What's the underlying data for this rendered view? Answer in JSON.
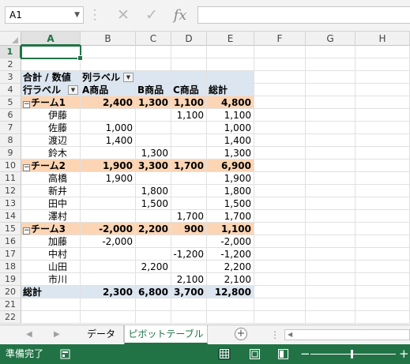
{
  "formula_bar": {
    "name_box": "A1",
    "fx_label": "fx",
    "formula_value": ""
  },
  "columns": [
    "A",
    "B",
    "C",
    "D",
    "E",
    "F",
    "G",
    "H"
  ],
  "rows": [
    {
      "n": "1",
      "cells": []
    },
    {
      "n": "2",
      "cells": []
    },
    {
      "n": "3",
      "style": "header",
      "cells": [
        {
          "col": "A",
          "v": "合計 / 数値",
          "align": "txt",
          "bold": true
        },
        {
          "col": "B",
          "v": "列ラベル",
          "align": "txt",
          "bold": true,
          "dropdown": true
        }
      ]
    },
    {
      "n": "4",
      "style": "header",
      "cells": [
        {
          "col": "A",
          "v": "行ラベル",
          "align": "txt",
          "bold": true,
          "dropdown": true
        },
        {
          "col": "B",
          "v": "A商品",
          "align": "txt",
          "bold": true
        },
        {
          "col": "C",
          "v": "B商品",
          "align": "txt",
          "bold": true
        },
        {
          "col": "D",
          "v": "C商品",
          "align": "txt",
          "bold": true
        },
        {
          "col": "E",
          "v": "総計",
          "align": "txt",
          "bold": true
        }
      ]
    },
    {
      "n": "5",
      "style": "team",
      "cells": [
        {
          "col": "A",
          "v": "チーム1",
          "align": "txt",
          "collapse": "⊟"
        },
        {
          "col": "B",
          "v": "2,400",
          "align": "num"
        },
        {
          "col": "C",
          "v": "1,300",
          "align": "num"
        },
        {
          "col": "D",
          "v": "1,100",
          "align": "num"
        },
        {
          "col": "E",
          "v": "4,800",
          "align": "num"
        }
      ]
    },
    {
      "n": "6",
      "cells": [
        {
          "col": "A",
          "v": "伊藤",
          "align": "ind"
        },
        {
          "col": "D",
          "v": "1,100",
          "align": "num"
        },
        {
          "col": "E",
          "v": "1,100",
          "align": "num"
        }
      ]
    },
    {
      "n": "7",
      "cells": [
        {
          "col": "A",
          "v": "佐藤",
          "align": "ind"
        },
        {
          "col": "B",
          "v": "1,000",
          "align": "num"
        },
        {
          "col": "E",
          "v": "1,000",
          "align": "num"
        }
      ]
    },
    {
      "n": "8",
      "cells": [
        {
          "col": "A",
          "v": "渡辺",
          "align": "ind"
        },
        {
          "col": "B",
          "v": "1,400",
          "align": "num"
        },
        {
          "col": "E",
          "v": "1,400",
          "align": "num"
        }
      ]
    },
    {
      "n": "9",
      "cells": [
        {
          "col": "A",
          "v": "鈴木",
          "align": "ind"
        },
        {
          "col": "C",
          "v": "1,300",
          "align": "num"
        },
        {
          "col": "E",
          "v": "1,300",
          "align": "num"
        }
      ]
    },
    {
      "n": "10",
      "style": "team",
      "cells": [
        {
          "col": "A",
          "v": "チーム2",
          "align": "txt",
          "collapse": "⊟"
        },
        {
          "col": "B",
          "v": "1,900",
          "align": "num"
        },
        {
          "col": "C",
          "v": "3,300",
          "align": "num"
        },
        {
          "col": "D",
          "v": "1,700",
          "align": "num"
        },
        {
          "col": "E",
          "v": "6,900",
          "align": "num"
        }
      ]
    },
    {
      "n": "11",
      "cells": [
        {
          "col": "A",
          "v": "高橋",
          "align": "ind"
        },
        {
          "col": "B",
          "v": "1,900",
          "align": "num"
        },
        {
          "col": "E",
          "v": "1,900",
          "align": "num"
        }
      ]
    },
    {
      "n": "12",
      "cells": [
        {
          "col": "A",
          "v": "新井",
          "align": "ind"
        },
        {
          "col": "C",
          "v": "1,800",
          "align": "num"
        },
        {
          "col": "E",
          "v": "1,800",
          "align": "num"
        }
      ]
    },
    {
      "n": "13",
      "cells": [
        {
          "col": "A",
          "v": "田中",
          "align": "ind"
        },
        {
          "col": "C",
          "v": "1,500",
          "align": "num"
        },
        {
          "col": "E",
          "v": "1,500",
          "align": "num"
        }
      ]
    },
    {
      "n": "14",
      "cells": [
        {
          "col": "A",
          "v": "澤村",
          "align": "ind"
        },
        {
          "col": "D",
          "v": "1,700",
          "align": "num"
        },
        {
          "col": "E",
          "v": "1,700",
          "align": "num"
        }
      ]
    },
    {
      "n": "15",
      "style": "team",
      "cells": [
        {
          "col": "A",
          "v": "チーム3",
          "align": "txt",
          "collapse": "⊟"
        },
        {
          "col": "B",
          "v": "-2,000",
          "align": "num"
        },
        {
          "col": "C",
          "v": "2,200",
          "align": "num"
        },
        {
          "col": "D",
          "v": "900",
          "align": "num"
        },
        {
          "col": "E",
          "v": "1,100",
          "align": "num"
        }
      ]
    },
    {
      "n": "16",
      "cells": [
        {
          "col": "A",
          "v": "加藤",
          "align": "ind"
        },
        {
          "col": "B",
          "v": "-2,000",
          "align": "num"
        },
        {
          "col": "E",
          "v": "-2,000",
          "align": "num"
        }
      ]
    },
    {
      "n": "17",
      "cells": [
        {
          "col": "A",
          "v": "中村",
          "align": "ind"
        },
        {
          "col": "D",
          "v": "-1,200",
          "align": "num"
        },
        {
          "col": "E",
          "v": "-1,200",
          "align": "num"
        }
      ]
    },
    {
      "n": "18",
      "cells": [
        {
          "col": "A",
          "v": "山田",
          "align": "ind"
        },
        {
          "col": "C",
          "v": "2,200",
          "align": "num"
        },
        {
          "col": "E",
          "v": "2,200",
          "align": "num"
        }
      ]
    },
    {
      "n": "19",
      "cells": [
        {
          "col": "A",
          "v": "市川",
          "align": "ind"
        },
        {
          "col": "D",
          "v": "2,100",
          "align": "num"
        },
        {
          "col": "E",
          "v": "2,100",
          "align": "num"
        }
      ]
    },
    {
      "n": "20",
      "style": "total",
      "cells": [
        {
          "col": "A",
          "v": "総計",
          "align": "txt"
        },
        {
          "col": "B",
          "v": "2,300",
          "align": "num"
        },
        {
          "col": "C",
          "v": "6,800",
          "align": "num"
        },
        {
          "col": "D",
          "v": "3,700",
          "align": "num"
        },
        {
          "col": "E",
          "v": "12,800",
          "align": "num"
        }
      ]
    },
    {
      "n": "21",
      "cells": []
    },
    {
      "n": "22",
      "cells": []
    }
  ],
  "sheet_tabs": {
    "tabs": [
      "データ",
      "ピボットテーブル"
    ],
    "active": "ピボットテーブル"
  },
  "status": {
    "text": "準備完了"
  },
  "colors": {
    "excel_green": "#217346",
    "pivot_header": "#dce6f1",
    "team_row": "#fcd5b4"
  }
}
